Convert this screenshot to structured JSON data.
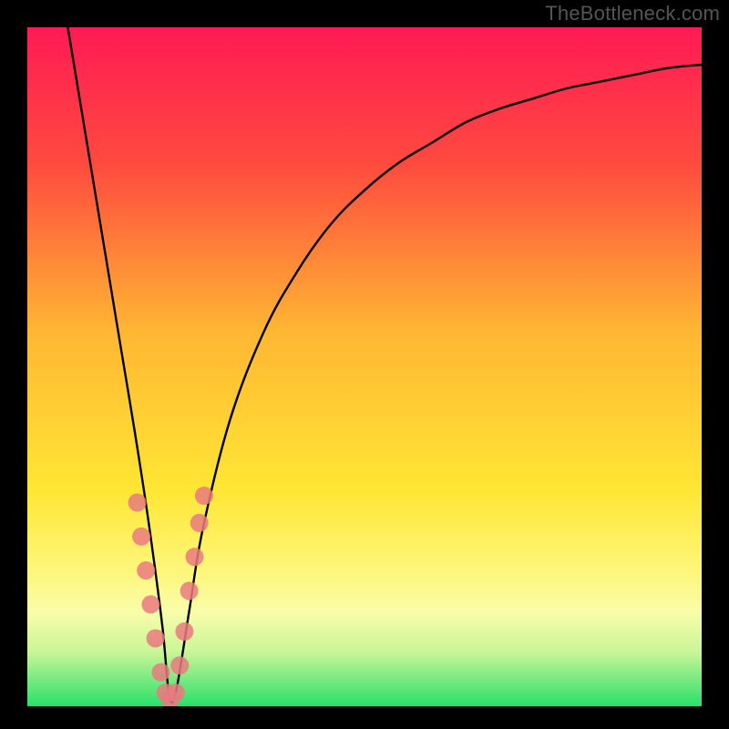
{
  "watermark": "TheBottleneck.com",
  "chart_data": {
    "type": "line",
    "title": "",
    "xlabel": "",
    "ylabel": "",
    "xlim": [
      0,
      100
    ],
    "ylim": [
      0,
      100
    ],
    "background_gradient_stops": [
      {
        "offset": 0,
        "color": "#ff1a55"
      },
      {
        "offset": 20,
        "color": "#ff4a3f"
      },
      {
        "offset": 45,
        "color": "#ffb733"
      },
      {
        "offset": 68,
        "color": "#ffe634"
      },
      {
        "offset": 80,
        "color": "#fdf67a"
      },
      {
        "offset": 86,
        "color": "#fafda9"
      },
      {
        "offset": 92,
        "color": "#c9f598"
      },
      {
        "offset": 100,
        "color": "#29e06a"
      }
    ],
    "series": [
      {
        "name": "bottleneck-curve",
        "x": [
          6,
          8,
          10,
          12,
          14,
          16,
          18,
          20,
          21,
          22,
          24,
          26,
          30,
          35,
          40,
          45,
          50,
          55,
          60,
          65,
          70,
          75,
          80,
          85,
          90,
          95,
          100
        ],
        "y": [
          100,
          88,
          76,
          64,
          52,
          40,
          27,
          12,
          2,
          2,
          14,
          26,
          42,
          55,
          64,
          71,
          76,
          80,
          83,
          86,
          88,
          89.5,
          91,
          92,
          93,
          94,
          94.5
        ]
      }
    ],
    "highlight_points": {
      "name": "highlight",
      "color": "#e97a7f",
      "x": [
        16.3,
        16.9,
        17.6,
        18.3,
        19.0,
        19.8,
        20.5,
        21.2,
        22.0,
        22.6,
        23.3,
        24.0,
        24.8,
        25.5,
        26.2
      ],
      "y": [
        30,
        25,
        20,
        15,
        10,
        5,
        2,
        1,
        2,
        6,
        11,
        17,
        22,
        27,
        31
      ]
    }
  }
}
